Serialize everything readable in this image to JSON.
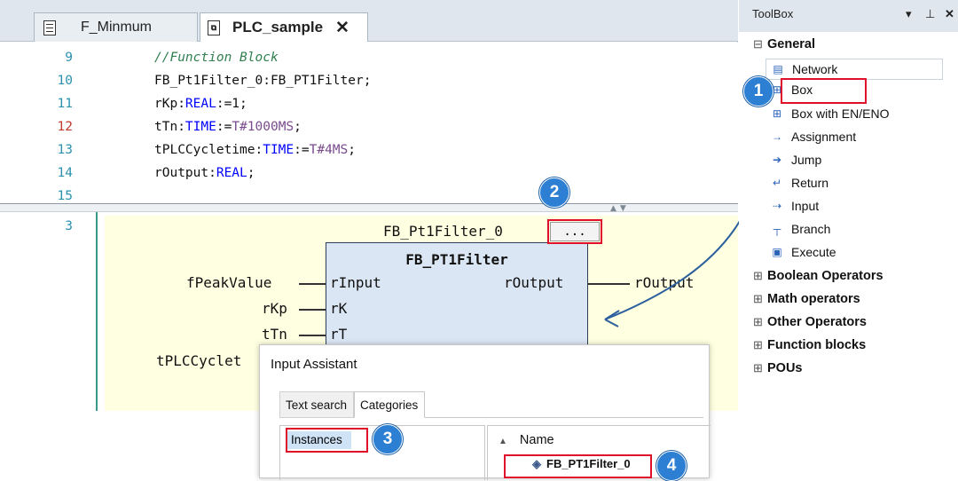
{
  "tabs": [
    {
      "label": "F_Minmum",
      "active": false
    },
    {
      "label": "PLC_sample",
      "active": true,
      "close_glyph": "✕"
    }
  ],
  "declaration": {
    "lines": [
      {
        "num": "9",
        "parts": [
          {
            "t": "//Function Block",
            "c": "cmt"
          }
        ]
      },
      {
        "num": "10",
        "parts": [
          {
            "t": "FB_Pt1Filter_0:FB_PT1Filter;",
            "c": ""
          }
        ]
      },
      {
        "num": "11",
        "parts": [
          {
            "t": "rKp:",
            "c": ""
          },
          {
            "t": "REAL",
            "c": "kw"
          },
          {
            "t": ":=1;",
            "c": ""
          }
        ]
      },
      {
        "num": "12",
        "parts": [
          {
            "t": "tTn:",
            "c": ""
          },
          {
            "t": "TIME",
            "c": "kw"
          },
          {
            "t": ":=",
            "c": ""
          },
          {
            "t": "T#1000MS",
            "c": "lit"
          },
          {
            "t": ";",
            "c": ""
          }
        ]
      },
      {
        "num": "13",
        "parts": [
          {
            "t": "tPLCCycletime:",
            "c": ""
          },
          {
            "t": "TIME",
            "c": "kw"
          },
          {
            "t": ":=",
            "c": ""
          },
          {
            "t": "T#4MS",
            "c": "lit"
          },
          {
            "t": ";",
            "c": ""
          }
        ]
      },
      {
        "num": "14",
        "parts": [
          {
            "t": "rOutput:",
            "c": ""
          },
          {
            "t": "REAL",
            "c": "kw"
          },
          {
            "t": ";",
            "c": ""
          }
        ]
      },
      {
        "num": "15",
        "parts": []
      }
    ]
  },
  "implementation": {
    "line_number": "3",
    "instance_name": "FB_Pt1Filter_0",
    "instance_button": "...",
    "block_type": "FB_PT1Filter",
    "inputs": [
      "rInput",
      "rK",
      "rT"
    ],
    "output_pin": "rOutput",
    "input_vars": [
      "fPeakValue",
      "rKp",
      "tTn",
      "tPLCCyclet"
    ],
    "output_var": "rOutput"
  },
  "toolbox": {
    "title": "ToolBox",
    "controls": {
      "dropdown": "▾",
      "pin": "⊥",
      "close": "✕"
    },
    "general_label": "General",
    "general_items": [
      {
        "label": "Network",
        "icon": "network-icon"
      },
      {
        "label": "Box",
        "icon": "box-icon"
      },
      {
        "label": "Box with EN/ENO",
        "icon": "box-en-eno-icon"
      },
      {
        "label": "Assignment",
        "icon": "assignment-icon"
      },
      {
        "label": "Jump",
        "icon": "jump-icon"
      },
      {
        "label": "Return",
        "icon": "return-icon"
      },
      {
        "label": "Input",
        "icon": "input-icon"
      },
      {
        "label": "Branch",
        "icon": "branch-icon"
      },
      {
        "label": "Execute",
        "icon": "execute-icon"
      }
    ],
    "categories": [
      "Boolean Operators",
      "Math operators",
      "Other Operators",
      "Function blocks",
      "POUs"
    ]
  },
  "input_assistant": {
    "title": "Input Assistant",
    "tabs": [
      "Text search",
      "Categories"
    ],
    "left_items": [
      "Instances"
    ],
    "column_header": "Name",
    "right_items": [
      "FB_PT1Filter_0"
    ]
  },
  "badges": [
    "1",
    "2",
    "3",
    "4"
  ],
  "colors": {
    "highlight": "#e0102a",
    "badge": "#2c7fd3",
    "keyword": "#0000ff",
    "comment": "#2f7f4f",
    "fb_fill": "#dbe6f4",
    "ladder_bg": "#ffffe1"
  }
}
